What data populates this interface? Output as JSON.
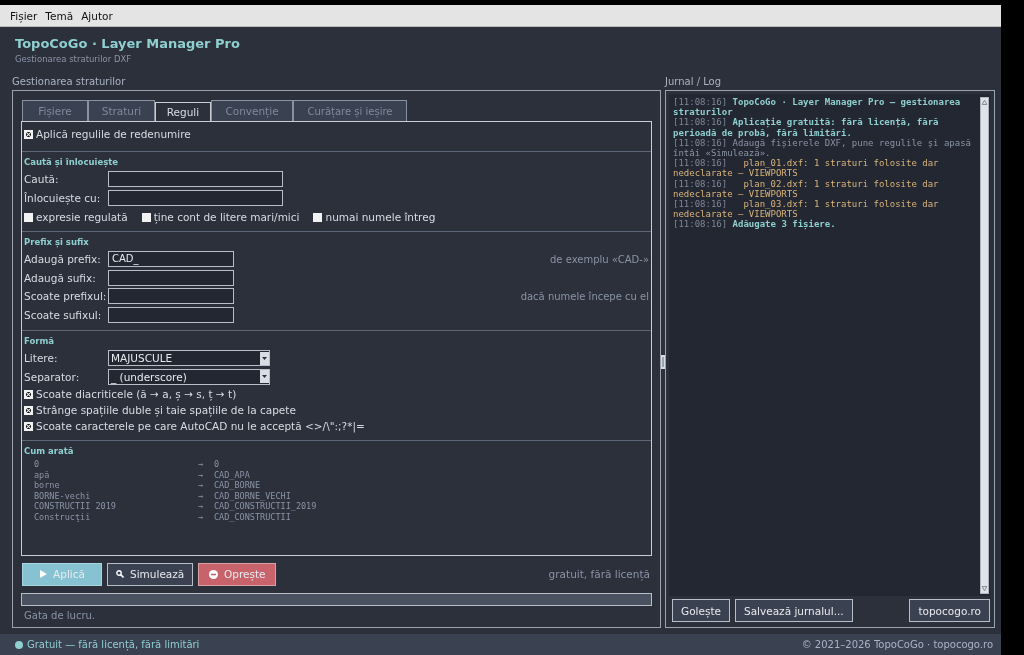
{
  "menu": [
    "Fișier",
    "Temă",
    "Ajutor"
  ],
  "header": {
    "title": "TopoCoGo · Layer Manager Pro",
    "subtitle": "Gestionarea straturilor DXF"
  },
  "left_panel": {
    "title": "Gestionarea straturilor",
    "tabs": [
      {
        "label": "Fișiere",
        "selected": false
      },
      {
        "label": "Straturi",
        "selected": false
      },
      {
        "label": "Reguli",
        "selected": true
      },
      {
        "label": "Convenție",
        "selected": false
      },
      {
        "label": "Curățare și ieșire",
        "selected": false
      }
    ],
    "apply_rules": {
      "label": "Aplică regulile de redenumire",
      "checked": true
    },
    "search_replace": {
      "title": "Caută și înlocuiește",
      "fields": [
        {
          "label": "Caută:"
        },
        {
          "label": "Înlocuiește cu:"
        }
      ],
      "options": [
        {
          "label": "expresie regulată",
          "checked": false
        },
        {
          "label": "ține cont de litere mari/mici",
          "checked": false
        },
        {
          "label": "numai numele întreg",
          "checked": false
        }
      ]
    },
    "prefix_suffix": {
      "title": "Prefix și sufix",
      "fields": [
        {
          "label": "Adaugă prefix:",
          "value": "CAD_",
          "hint": "de exemplu «CAD-»"
        },
        {
          "label": "Adaugă sufix:"
        },
        {
          "label": "Scoate prefixul:",
          "hint": "dacă numele începe cu el"
        },
        {
          "label": "Scoate sufixul:"
        }
      ]
    },
    "form": {
      "title": "Formă",
      "dropdowns": [
        {
          "label": "Litere:",
          "value": "MAJUSCULE"
        },
        {
          "label": "Separator:",
          "value": "_ (underscore)"
        }
      ],
      "options": [
        {
          "label": "Scoate diacriticele (ă → a, ș → s, ț → t)",
          "checked": true
        },
        {
          "label": "Strânge spațiile duble și taie spațiile de la capete",
          "checked": true
        },
        {
          "label": "Scoate caracterele pe care AutoCAD nu le acceptă  <>/\\\":;?*|=",
          "checked": true
        }
      ]
    },
    "preview": {
      "title": "Cum arată",
      "rows": [
        {
          "source": "0",
          "arrow": "→",
          "target": "0"
        },
        {
          "source": "apă",
          "arrow": "→",
          "target": "CAD_APA"
        },
        {
          "source": "borne",
          "arrow": "→",
          "target": "CAD_BORNE"
        },
        {
          "source": "BORNE-vechi",
          "arrow": "→",
          "target": "CAD_BORNE_VECHI"
        },
        {
          "source": "CONSTRUCTII 2019",
          "arrow": "→",
          "target": "CAD_CONSTRUCTII_2019"
        },
        {
          "source": "Construcţii",
          "arrow": "→",
          "target": "CAD_CONSTRUCTII"
        }
      ]
    },
    "buttons": [
      {
        "label": "Aplică",
        "kind": "primary"
      },
      {
        "label": "Simulează",
        "kind": "secondary"
      },
      {
        "label": "Oprește",
        "kind": "danger"
      }
    ],
    "license_note": "gratuit, fără licență",
    "progress": {
      "level": 0
    },
    "status": "Gata de lucru."
  },
  "log_panel": {
    "title": "Jurnal / Log",
    "entries": [
      {
        "time": "[11:08:16]",
        "text": "TopoCoGo · Layer Manager Pro — gestionarea straturilor",
        "kind": "info"
      },
      {
        "time": "[11:08:16]",
        "text": "Aplicație gratuită: fără licență, fără perioadă de probă, fără limitări.",
        "kind": "info"
      },
      {
        "time": "[11:08:16]",
        "text": "Adaugă fișierele DXF, pune regulile și apasă întâi «Simulează».",
        "kind": "normal"
      },
      {
        "time": "[11:08:16]",
        "text": "  plan_01.dxf: 1 straturi folosite dar nedeclarate — VIEWPORTS",
        "kind": "warning"
      },
      {
        "time": "[11:08:16]",
        "text": "  plan_02.dxf: 1 straturi folosite dar nedeclarate — VIEWPORTS",
        "kind": "warning"
      },
      {
        "time": "[11:08:16]",
        "text": "  plan_03.dxf: 1 straturi folosite dar nedeclarate — VIEWPORTS",
        "kind": "warning"
      },
      {
        "time": "[11:08:16]",
        "text": "Adăugate 3 fișiere.",
        "kind": "info"
      }
    ],
    "buttons": [
      "Golește",
      "Salvează jurnalul...",
      "topocogo.ro"
    ]
  },
  "footer": {
    "left": "Gratuit — fără licență, fără limitări",
    "right": "© 2021–2026 TopoCoGo · topocogo.ro"
  }
}
